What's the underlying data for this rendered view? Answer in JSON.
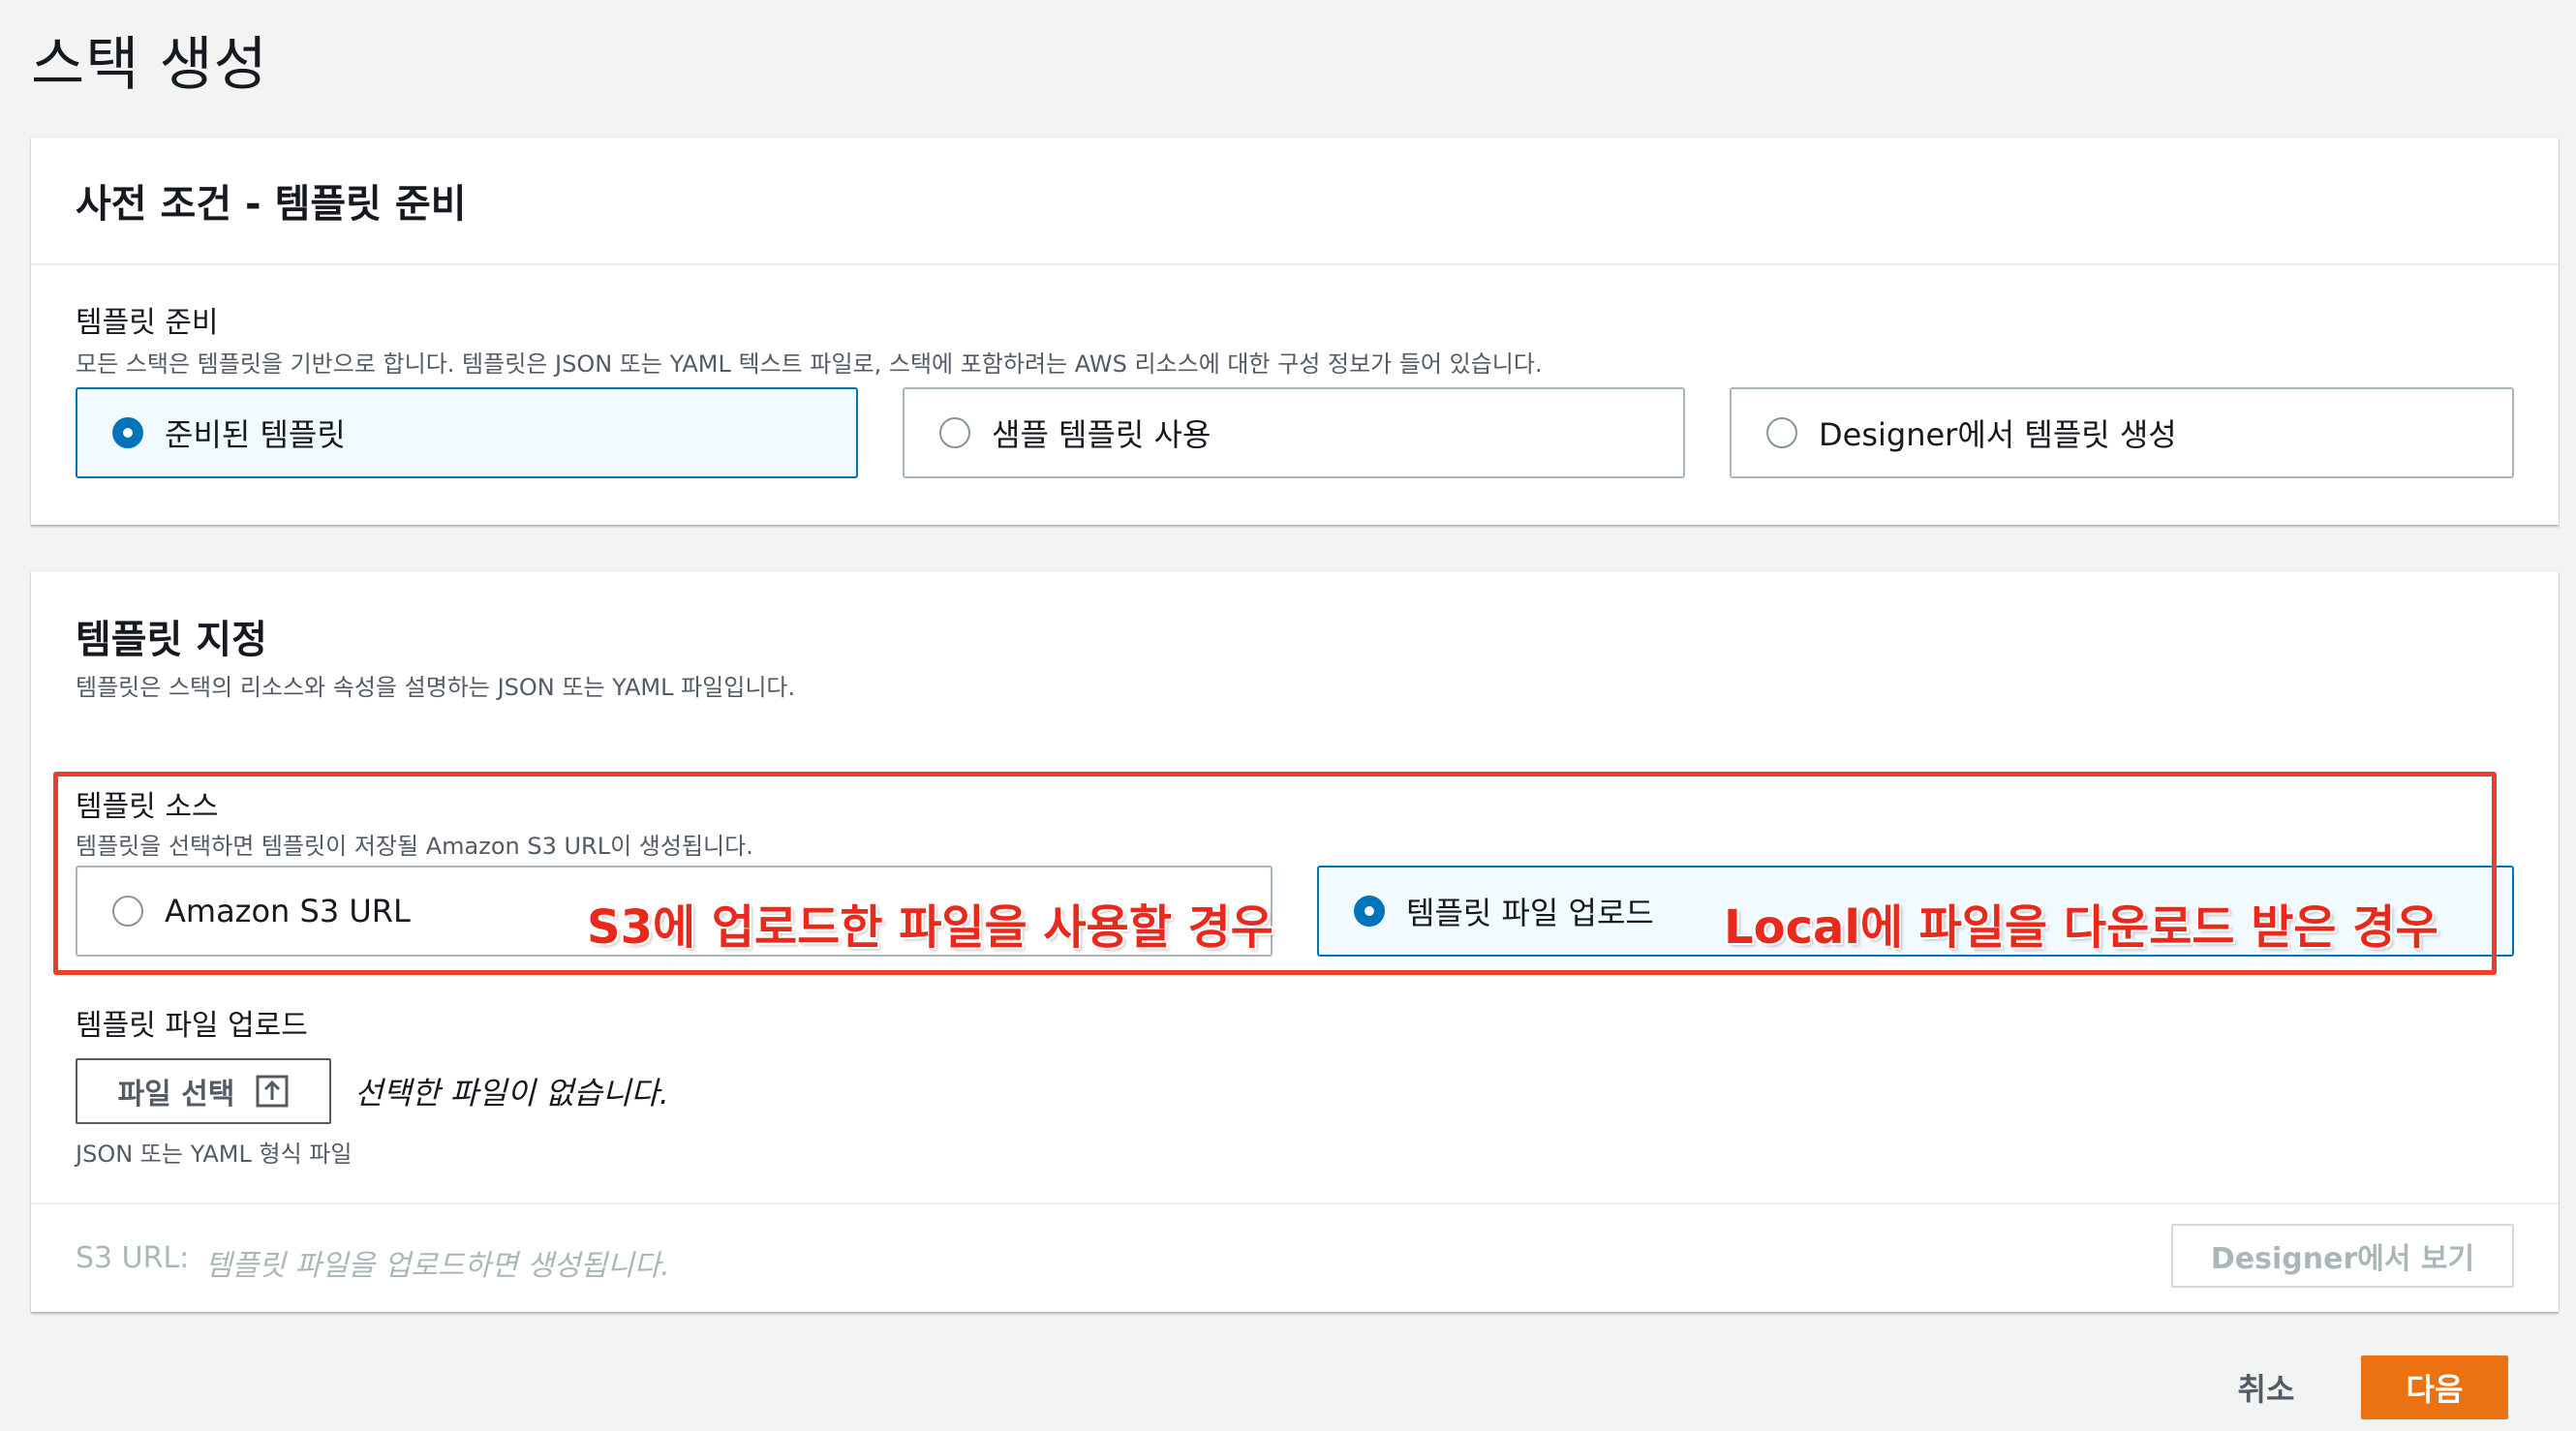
{
  "page": {
    "title": "스택 생성"
  },
  "prereq": {
    "heading": "사전 조건 - 템플릿 준비",
    "field_label": "템플릿 준비",
    "field_desc": "모든 스택은 템플릿을 기반으로 합니다. 템플릿은 JSON 또는 YAML 텍스트 파일로, 스택에 포함하려는 AWS 리소스에 대한 구성 정보가 들어 있습니다.",
    "options": [
      {
        "label": "준비된 템플릿",
        "selected": true
      },
      {
        "label": "샘플 템플릿 사용",
        "selected": false
      },
      {
        "label": "Designer에서 템플릿 생성",
        "selected": false
      }
    ]
  },
  "specify": {
    "heading": "템플릿 지정",
    "desc": "템플릿은 스택의 리소스와 속성을 설명하는 JSON 또는 YAML 파일입니다.",
    "source_label": "템플릿 소스",
    "source_desc": "템플릿을 선택하면 템플릿이 저장될 Amazon S3 URL이 생성됩니다.",
    "source_options": [
      {
        "label": "Amazon S3 URL",
        "selected": false
      },
      {
        "label": "템플릿 파일 업로드",
        "selected": true
      }
    ],
    "upload_label": "템플릿 파일 업로드",
    "choose_file_label": "파일 선택",
    "no_file_text": "선택한 파일이 없습니다.",
    "file_hint": "JSON 또는 YAML 형식 파일",
    "s3url_label": "S3 URL:",
    "s3url_value": "템플릿 파일을 업로드하면 생성됩니다.",
    "designer_button": "Designer에서 보기"
  },
  "annotations": {
    "s3_note": "S3에 업로드한 파일을 사용할 경우",
    "local_note": "Local에 파일을 다운로드 받은 경우"
  },
  "footer": {
    "cancel_label": "취소",
    "next_label": "다음"
  },
  "colors": {
    "accent_blue": "#0073bb",
    "primary_orange": "#ec7211",
    "annotation_red": "#e8291c"
  }
}
